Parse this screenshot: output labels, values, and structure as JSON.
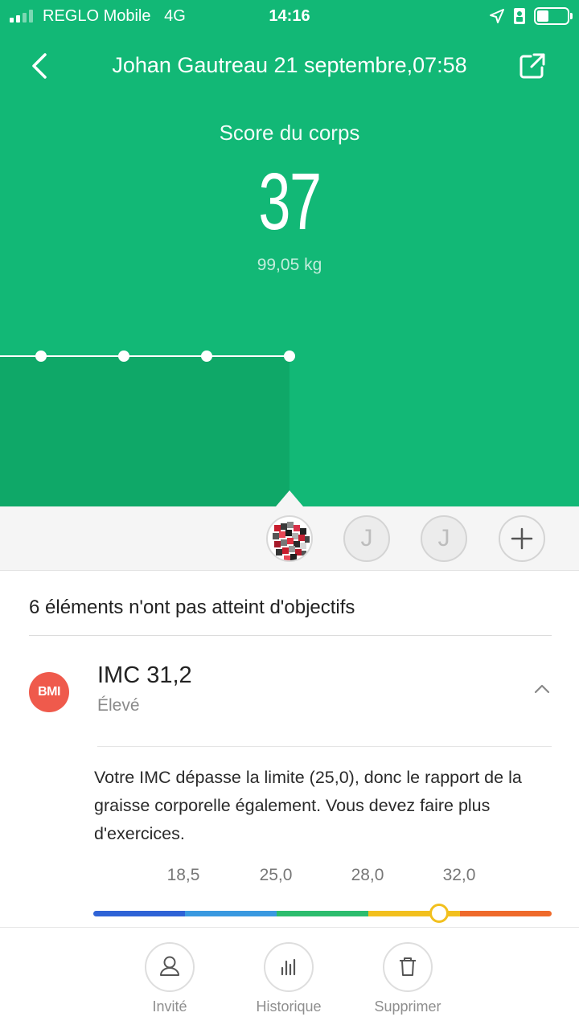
{
  "status_bar": {
    "carrier": "REGLO Mobile",
    "network": "4G",
    "time": "14:16",
    "signal_bars": 4,
    "signal_bars_active": 2
  },
  "header": {
    "title": "Johan Gautreau 21 septembre,07:58",
    "back_icon": "chevron-left-icon",
    "share_icon": "share-icon"
  },
  "score": {
    "label": "Score du corps",
    "value": "37",
    "weight": "99,05 kg"
  },
  "trend_chart": {
    "points": [
      1,
      1,
      1,
      1
    ],
    "colors": {
      "background": "#12b876",
      "line": "#ffffff"
    }
  },
  "users": [
    {
      "type": "photo",
      "initial": ""
    },
    {
      "type": "guest",
      "initial": "J"
    },
    {
      "type": "guest",
      "initial": "J"
    },
    {
      "type": "add",
      "initial": ""
    }
  ],
  "goals": {
    "summary": "6 éléments n'ont pas atteint d'objectifs"
  },
  "bmi": {
    "badge": "BMI",
    "title": "IMC 31,2",
    "status": "Élevé",
    "description": "Votre IMC dépasse la limite (25,0), donc le rapport de la graisse corporelle également. Vous devez faire plus d'exercices.",
    "thresholds": [
      "18,5",
      "25,0",
      "28,0",
      "32,0"
    ],
    "segment_colors": [
      "#2f63d6",
      "#3a99e0",
      "#2dbd6e",
      "#f2c01e",
      "#ef6a2b"
    ],
    "marker_fraction": 0.755,
    "badge_color": "#ef5a4c"
  },
  "bottom_bar": {
    "items": [
      {
        "label": "Invité",
        "icon": "person-icon"
      },
      {
        "label": "Historique",
        "icon": "bar-chart-icon"
      },
      {
        "label": "Supprimer",
        "icon": "trash-icon"
      }
    ]
  }
}
